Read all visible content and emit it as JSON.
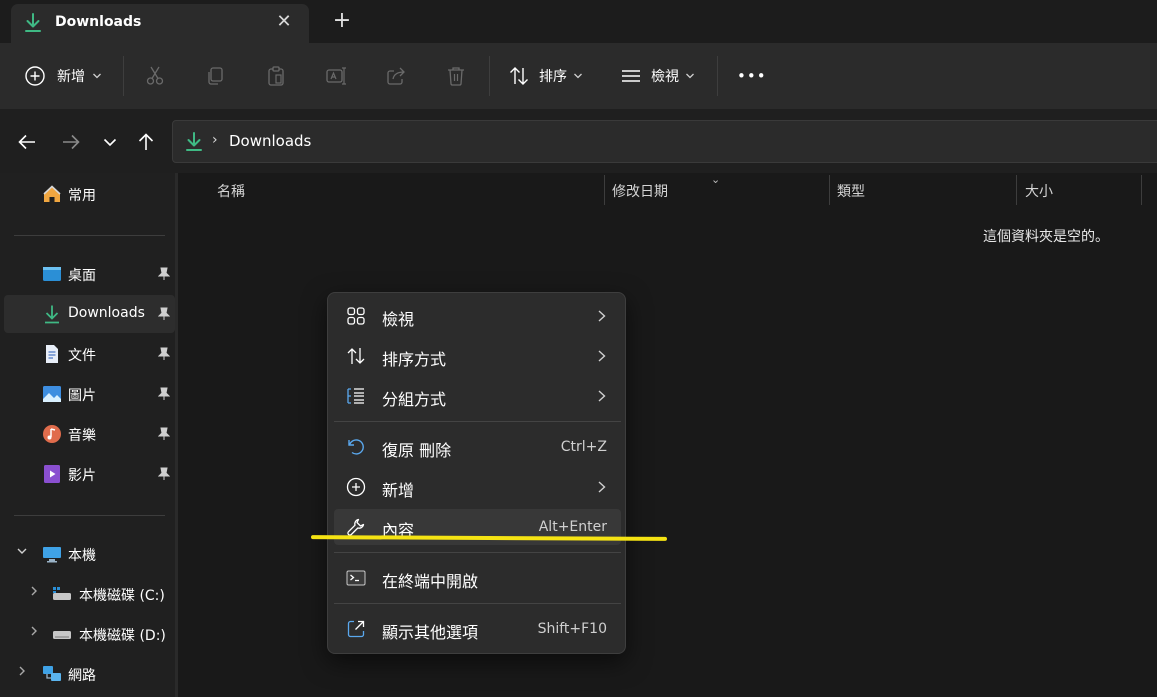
{
  "tab": {
    "title": "Downloads",
    "close": "✕",
    "new_tab": "+"
  },
  "toolbar": {
    "new_label": "新增",
    "sort_label": "排序",
    "view_label": "檢視",
    "more": "•••"
  },
  "address": {
    "chevron": "›",
    "path": "Downloads"
  },
  "sidebar": {
    "home": "常用",
    "quick_access": [
      {
        "label": "桌面",
        "icon": "desktop-icon",
        "color": "#2b8fd6"
      },
      {
        "label": "Downloads",
        "icon": "download-icon",
        "color": "#3fb984"
      },
      {
        "label": "文件",
        "icon": "document-icon",
        "color": "#6a8bc7"
      },
      {
        "label": "圖片",
        "icon": "picture-icon",
        "color": "#3e8ee0"
      },
      {
        "label": "音樂",
        "icon": "music-icon",
        "color": "#e06c4c"
      },
      {
        "label": "影片",
        "icon": "video-icon",
        "color": "#8a4fd0"
      }
    ],
    "this_pc": "本機",
    "drive_c": "本機磁碟 (C:)",
    "drive_d": "本機磁碟 (D:)",
    "network": "網路"
  },
  "columns": {
    "name": "名稱",
    "modified": "修改日期",
    "type": "類型",
    "size": "大小"
  },
  "empty_message": "這個資料夾是空的。",
  "context_menu": {
    "view": "檢視",
    "sort_by": "排序方式",
    "group_by": "分組方式",
    "undo_delete": "復原 刪除",
    "undo_shortcut": "Ctrl+Z",
    "new": "新增",
    "properties": "內容",
    "properties_shortcut": "Alt+Enter",
    "open_terminal": "在終端中開啟",
    "more_options": "顯示其他選項",
    "more_options_shortcut": "Shift+F10"
  },
  "colors": {
    "accent_green": "#3fb984",
    "highlight": "#f5e313"
  }
}
